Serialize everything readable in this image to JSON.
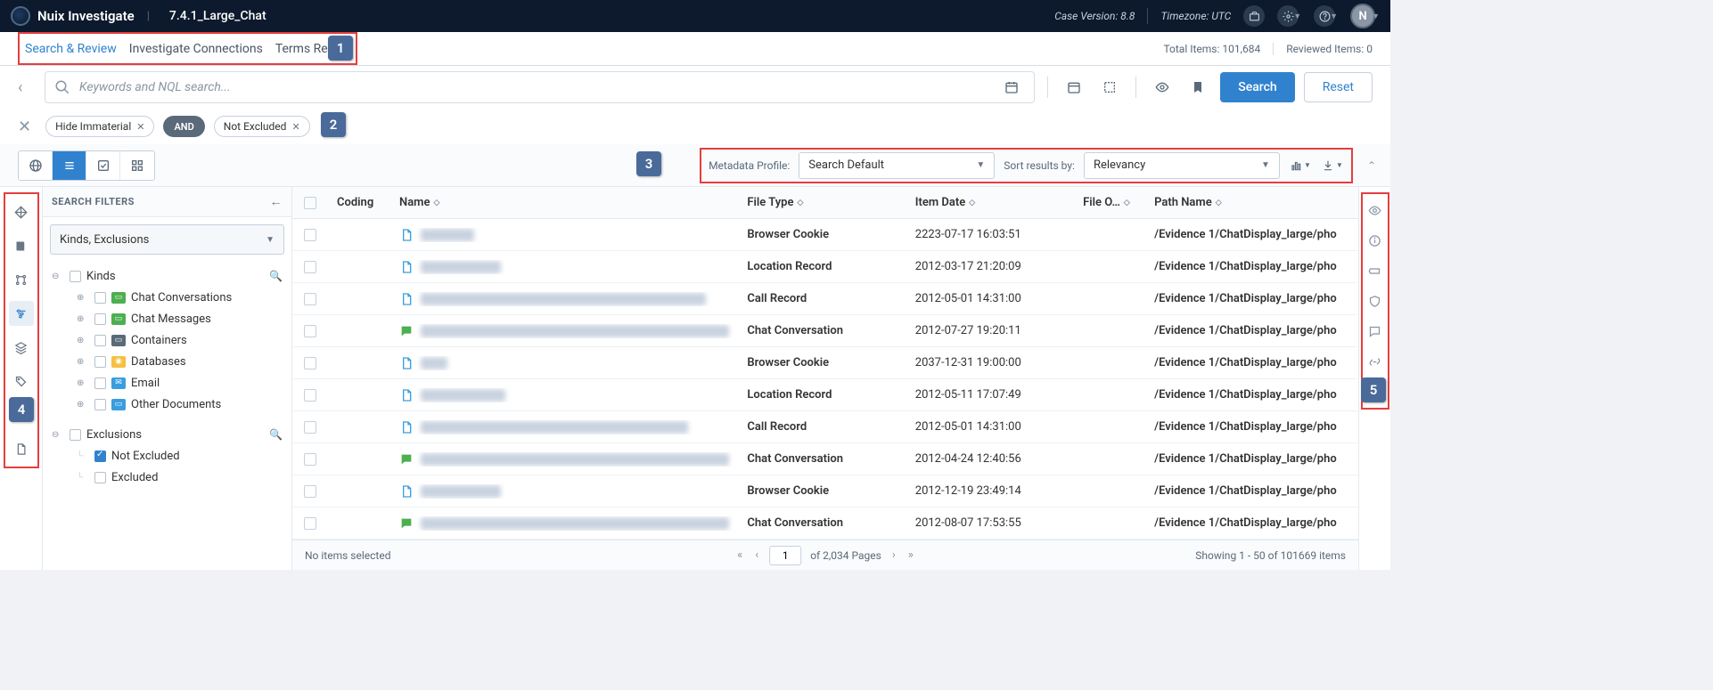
{
  "header": {
    "app_name": "Nuix Investigate",
    "case_name": "7.4.1_Large_Chat",
    "case_version_label": "Case Version: 8.8",
    "timezone_label": "Timezone: UTC",
    "user_initial": "N"
  },
  "tabs": {
    "items": [
      "Search & Review",
      "Investigate Connections",
      "Terms Report"
    ],
    "active_index": 0,
    "total_items_label": "Total Items: 101,684",
    "reviewed_items_label": "Reviewed Items: 0"
  },
  "search": {
    "placeholder": "Keywords and NQL search...",
    "search_btn": "Search",
    "reset_btn": "Reset"
  },
  "chips": {
    "chip1": "Hide Immaterial",
    "and": "AND",
    "chip2": "Not Excluded"
  },
  "view": {
    "metadata_label": "Metadata Profile:",
    "metadata_value": "Search Default",
    "sort_label": "Sort results by:",
    "sort_value": "Relevancy"
  },
  "sidebar": {
    "title": "SEARCH FILTERS",
    "select_label": "Kinds, Exclusions",
    "kinds_label": "Kinds",
    "kinds": [
      {
        "label": "Chat Conversations",
        "color": "#4caf50",
        "glyph": "▭"
      },
      {
        "label": "Chat Messages",
        "color": "#4caf50",
        "glyph": "▭"
      },
      {
        "label": "Containers",
        "color": "#5a6a7a",
        "glyph": "▭"
      },
      {
        "label": "Databases",
        "color": "#f6c042",
        "glyph": "◉"
      },
      {
        "label": "Email",
        "color": "#3a9dde",
        "glyph": "✉"
      },
      {
        "label": "Other Documents",
        "color": "#3a9dde",
        "glyph": "▭"
      }
    ],
    "exclusions_label": "Exclusions",
    "exclusions": [
      {
        "label": "Not Excluded",
        "checked": true
      },
      {
        "label": "Excluded",
        "checked": false
      }
    ]
  },
  "table": {
    "headers": {
      "coding": "Coding",
      "name": "Name",
      "file_type": "File Type",
      "item_date": "Item Date",
      "file_o": "File O…",
      "path": "Path Name"
    },
    "rows": [
      {
        "icon": "page",
        "name_blur": "w60",
        "file_type": "Browser Cookie",
        "date": "2223-07-17 16:03:51",
        "path": "/Evidence 1/ChatDisplay_large/pho"
      },
      {
        "icon": "page",
        "name_blur": "w90",
        "file_type": "Location Record",
        "date": "2012-03-17 21:20:09",
        "path": "/Evidence 1/ChatDisplay_large/pho"
      },
      {
        "icon": "page",
        "name_blur": "w320",
        "file_type": "Call Record",
        "date": "2012-05-01 14:31:00",
        "path": "/Evidence 1/ChatDisplay_large/pho"
      },
      {
        "icon": "chat",
        "name_blur": "w400",
        "file_type": "Chat Conversation",
        "date": "2012-07-27 19:20:11",
        "path": "/Evidence 1/ChatDisplay_large/pho"
      },
      {
        "icon": "page",
        "name_blur": "w30",
        "file_type": "Browser Cookie",
        "date": "2037-12-31 19:00:00",
        "path": "/Evidence 1/ChatDisplay_large/pho"
      },
      {
        "icon": "page",
        "name_blur": "w95",
        "file_type": "Location Record",
        "date": "2012-05-11 17:07:49",
        "path": "/Evidence 1/ChatDisplay_large/pho"
      },
      {
        "icon": "page",
        "name_blur": "w300",
        "file_type": "Call Record",
        "date": "2012-05-01 14:31:00",
        "path": "/Evidence 1/ChatDisplay_large/pho"
      },
      {
        "icon": "chat",
        "name_blur": "w410",
        "file_type": "Chat Conversation",
        "date": "2012-04-24 12:40:56",
        "path": "/Evidence 1/ChatDisplay_large/pho"
      },
      {
        "icon": "page",
        "name_blur": "w90",
        "file_type": "Browser Cookie",
        "date": "2012-12-19 23:49:14",
        "path": "/Evidence 1/ChatDisplay_large/pho"
      },
      {
        "icon": "chat",
        "name_blur": "w400",
        "file_type": "Chat Conversation",
        "date": "2012-08-07 17:53:55",
        "path": "/Evidence 1/ChatDisplay_large/pho"
      }
    ]
  },
  "pager": {
    "no_selection": "No items selected",
    "page_current": "1",
    "page_total": "of 2,034 Pages",
    "showing": "Showing 1 - 50 of 101669 items"
  },
  "callouts": {
    "c1": "1",
    "c2": "2",
    "c3": "3",
    "c4": "4",
    "c5": "5"
  }
}
